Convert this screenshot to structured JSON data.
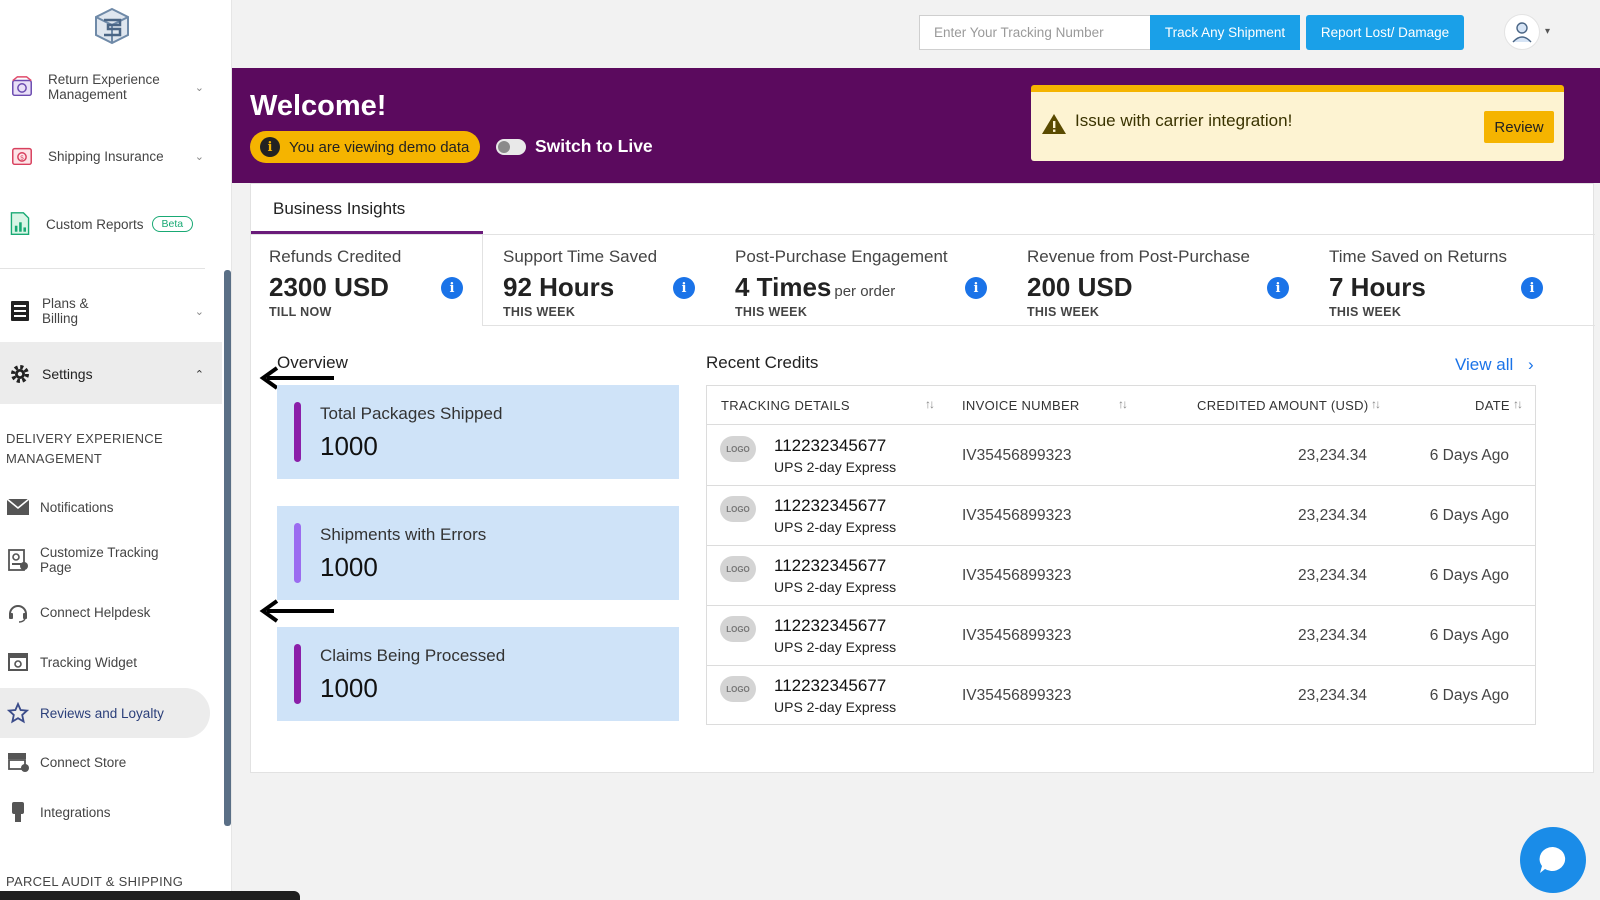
{
  "sidebar": {
    "items": [
      {
        "label": "Return Experience Management",
        "icon": "returns-icon"
      },
      {
        "label": "Shipping Insurance",
        "icon": "insurance-icon"
      },
      {
        "label": "Custom Reports",
        "badge": "Beta",
        "icon": "reports-icon"
      },
      {
        "label": "Plans & Billing",
        "icon": "billing-icon"
      },
      {
        "label": "Settings",
        "icon": "gear-icon"
      }
    ],
    "section_delivery": "DELIVERY EXPERIENCE MANAGEMENT",
    "delivery_items": [
      {
        "label": "Notifications",
        "icon": "mail-icon"
      },
      {
        "label": "Customize Tracking Page",
        "icon": "tracking-page-icon"
      },
      {
        "label": "Connect Helpdesk",
        "icon": "headset-icon"
      },
      {
        "label": "Tracking Widget",
        "icon": "widget-icon"
      },
      {
        "label": "Reviews and Loyalty",
        "icon": "star-icon"
      },
      {
        "label": "Connect Store",
        "icon": "store-icon"
      },
      {
        "label": "Integrations",
        "icon": "plug-icon"
      }
    ],
    "section_parcel": "PARCEL AUDIT & SHIPPING"
  },
  "topbar": {
    "tracking_placeholder": "Enter Your Tracking Number",
    "track_button": "Track Any Shipment",
    "report_button": "Report Lost/ Damage"
  },
  "banner": {
    "welcome": "Welcome!",
    "demo_text": "You are viewing demo data",
    "switch_label": "Switch to Live",
    "alert_text": "Issue with carrier integration!",
    "review_button": "Review"
  },
  "insights": {
    "tab": "Business Insights",
    "metrics": [
      {
        "label": "Refunds Credited",
        "value": "2300 USD",
        "suffix": "",
        "sub": "TILL NOW"
      },
      {
        "label": "Support Time Saved",
        "value": "92 Hours",
        "suffix": "",
        "sub": "THIS WEEK"
      },
      {
        "label": "Post-Purchase Engagement",
        "value": "4 Times",
        "suffix": "per order",
        "sub": "THIS WEEK"
      },
      {
        "label": "Revenue from Post-Purchase",
        "value": "200 USD",
        "suffix": "",
        "sub": "THIS WEEK"
      },
      {
        "label": "Time Saved on Returns",
        "value": "7 Hours",
        "suffix": "",
        "sub": "THIS WEEK"
      }
    ]
  },
  "overview": {
    "title": "Overview",
    "cards": [
      {
        "label": "Total Packages Shipped",
        "value": "1000",
        "color": "#8b1fa9"
      },
      {
        "label": "Shipments with Errors",
        "value": "1000",
        "color": "#9b6cf0"
      },
      {
        "label": "Claims Being Processed",
        "value": "1000",
        "color": "#8b1fa9"
      }
    ]
  },
  "recent_credits": {
    "title": "Recent Credits",
    "view_all": "View all",
    "headers": [
      "TRACKING DETAILS",
      "INVOICE NUMBER",
      "CREDITED AMOUNT (USD)",
      "DATE"
    ],
    "logo_text": "LOGO",
    "rows": [
      {
        "tracking": "112232345677",
        "carrier": "UPS 2-day Express",
        "invoice": "IV35456899323",
        "amount": "23,234.34",
        "date": "6 Days Ago"
      },
      {
        "tracking": "112232345677",
        "carrier": "UPS 2-day Express",
        "invoice": "IV35456899323",
        "amount": "23,234.34",
        "date": "6 Days Ago"
      },
      {
        "tracking": "112232345677",
        "carrier": "UPS 2-day Express",
        "invoice": "IV35456899323",
        "amount": "23,234.34",
        "date": "6 Days Ago"
      },
      {
        "tracking": "112232345677",
        "carrier": "UPS 2-day Express",
        "invoice": "IV35456899323",
        "amount": "23,234.34",
        "date": "6 Days Ago"
      },
      {
        "tracking": "112232345677",
        "carrier": "UPS 2-day Express",
        "invoice": "IV35456899323",
        "amount": "23,234.34",
        "date": "6 Days Ago"
      }
    ]
  },
  "colors": {
    "banner": "#5b0a5e",
    "accent_blue": "#1aa0e8",
    "warning": "#f5b400"
  }
}
